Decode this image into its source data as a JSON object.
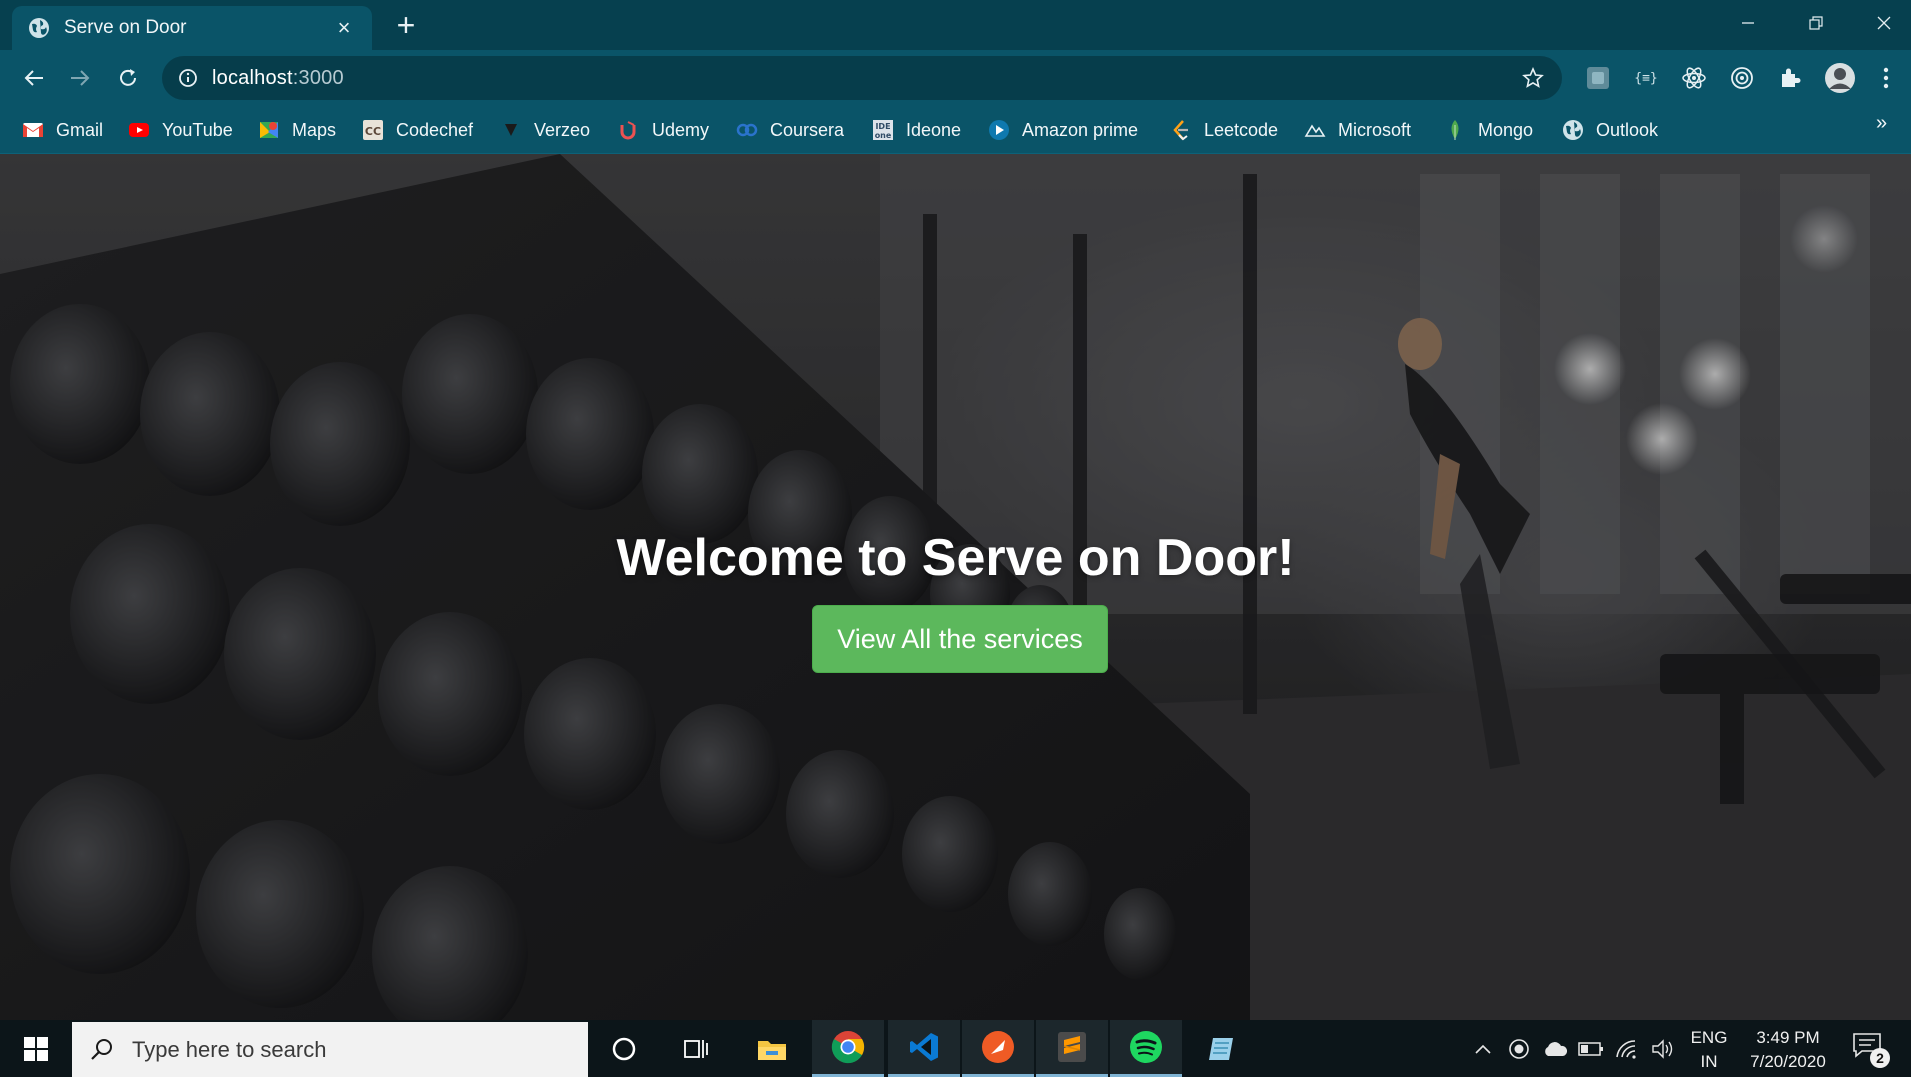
{
  "browser": {
    "tab_title": "Serve on Door",
    "tab_close": "×",
    "new_tab": "+",
    "url_host": "localhost",
    "url_port": ":3000"
  },
  "bookmarks": [
    {
      "label": "Gmail",
      "icon": "gmail-icon",
      "color": "#ea4335"
    },
    {
      "label": "YouTube",
      "icon": "youtube-icon",
      "color": "#ff0000"
    },
    {
      "label": "Maps",
      "icon": "maps-icon",
      "color": "#34a853"
    },
    {
      "label": "Codechef",
      "icon": "codechef-icon",
      "color": "#5b4638"
    },
    {
      "label": "Verzeo",
      "icon": "verzeo-icon",
      "color": "#222222"
    },
    {
      "label": "Udemy",
      "icon": "udemy-icon",
      "color": "#ec5252"
    },
    {
      "label": "Coursera",
      "icon": "coursera-icon",
      "color": "#2a73cc"
    },
    {
      "label": "Ideone",
      "icon": "ideone-icon",
      "color": "#4b6a88"
    },
    {
      "label": "Amazon prime",
      "icon": "prime-video-icon",
      "color": "#00a8e1"
    },
    {
      "label": "Leetcode",
      "icon": "leetcode-icon",
      "color": "#ffa116"
    },
    {
      "label": "Microsoft",
      "icon": "microsoft-icon",
      "color": "#1b1b1b"
    },
    {
      "label": "Mongo",
      "icon": "mongo-leaf-icon",
      "color": "#4fa94d"
    },
    {
      "label": "Outlook",
      "icon": "globe-icon",
      "color": "#cfe3e9"
    }
  ],
  "bookmarks_more": "»",
  "page": {
    "hero_title": "Welcome to Serve on Door!",
    "hero_button": "View All the services",
    "button_color": "#5cb85c"
  },
  "taskbar": {
    "search_placeholder": "Type here to search",
    "apps": [
      "cortana-icon",
      "task-view-icon",
      "file-explorer-icon",
      "chrome-icon",
      "vscode-icon",
      "postman-icon",
      "sublime-text-icon",
      "spotify-icon",
      "notepad-icon"
    ],
    "lang_line1": "ENG",
    "lang_line2": "IN",
    "time": "3:49 PM",
    "date": "7/20/2020",
    "notifications": "2"
  }
}
